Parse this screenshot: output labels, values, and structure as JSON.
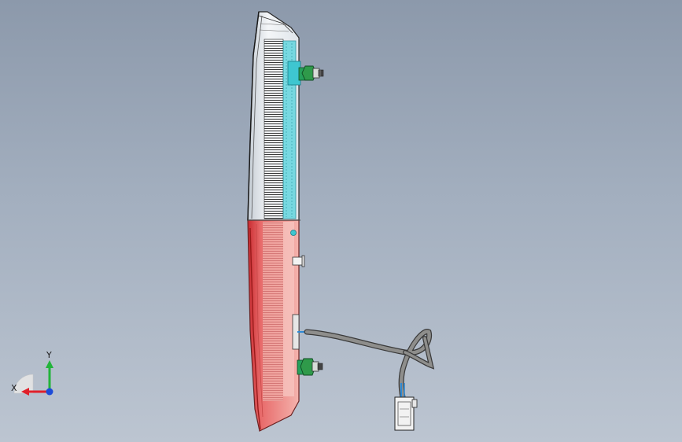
{
  "viewport": {
    "background_top": "#8c99ab",
    "background_bottom": "#bcc5d1"
  },
  "model": {
    "name": "tail-lamp-assembly",
    "lens_clear_color": "#e8eef2",
    "lens_red_color": "#e46a6a",
    "reflector_color": "#43d4e0",
    "nut_color": "#2f9a4a",
    "harness_color": "#7a7a78"
  },
  "triad": {
    "x_label": "X",
    "y_label": "Y",
    "x_color": "#e0202a",
    "y_color": "#22b43a",
    "z_color": "#1d4bd8"
  }
}
